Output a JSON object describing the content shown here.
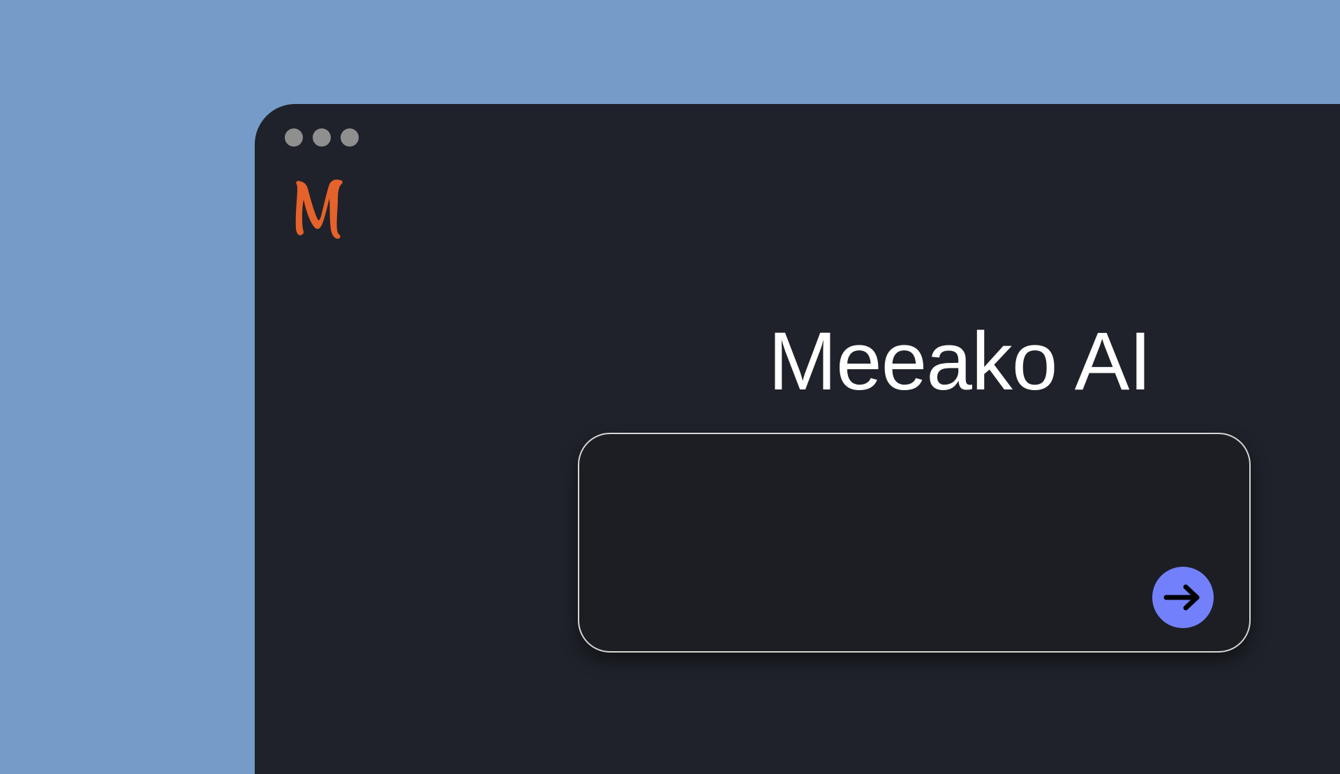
{
  "app": {
    "title": "Meeako AI"
  },
  "window": {
    "traffic_lights": [
      "dot",
      "dot",
      "dot"
    ]
  },
  "logo": {
    "icon": "meeako-m-logo-icon",
    "letter": "M",
    "color": "#e5622a"
  },
  "prompt": {
    "value": "",
    "placeholder": ""
  },
  "submit": {
    "icon": "arrow-right-icon",
    "color": "#7281fb"
  },
  "colors": {
    "background": "#759cc8",
    "window": "#1f222a",
    "prompt_box": "#1c1e24",
    "traffic_light": "#8f8f8f"
  }
}
